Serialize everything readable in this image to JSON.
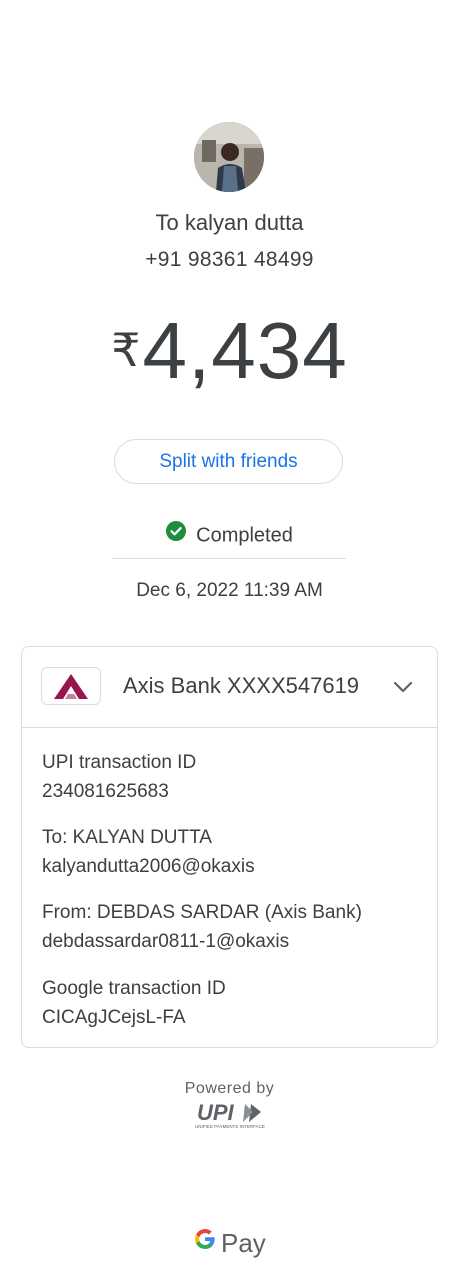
{
  "recipient": {
    "name": "To kalyan dutta",
    "phone": "+91 98361 48499"
  },
  "payment": {
    "currency_symbol": "₹",
    "amount": "4,434"
  },
  "actions": {
    "split_label": "Split with friends"
  },
  "status": {
    "label": "Completed",
    "datetime": "Dec 6, 2022 11:39 AM",
    "color": "#1e8e3e"
  },
  "account": {
    "bank_label": "Axis Bank XXXX547619",
    "bank_brand_color": "#97144d"
  },
  "details": {
    "upi_txn_title": "UPI transaction ID",
    "upi_txn_value": "234081625683",
    "to_title": "To: KALYAN DUTTA",
    "to_value": "kalyandutta2006@okaxis",
    "from_title": "From: DEBDAS SARDAR (Axis Bank)",
    "from_value": "debdassardar0811-1@okaxis",
    "google_txn_title": "Google transaction ID",
    "google_txn_value": "CICAgJCejsL-FA"
  },
  "footer": {
    "powered_by": "Powered by",
    "upi_logo_text": "UPI",
    "upi_tagline": "UNIFIED PAYMENTS INTERFACE",
    "gpay_label": "Pay"
  },
  "accent_color": "#1a73e8"
}
